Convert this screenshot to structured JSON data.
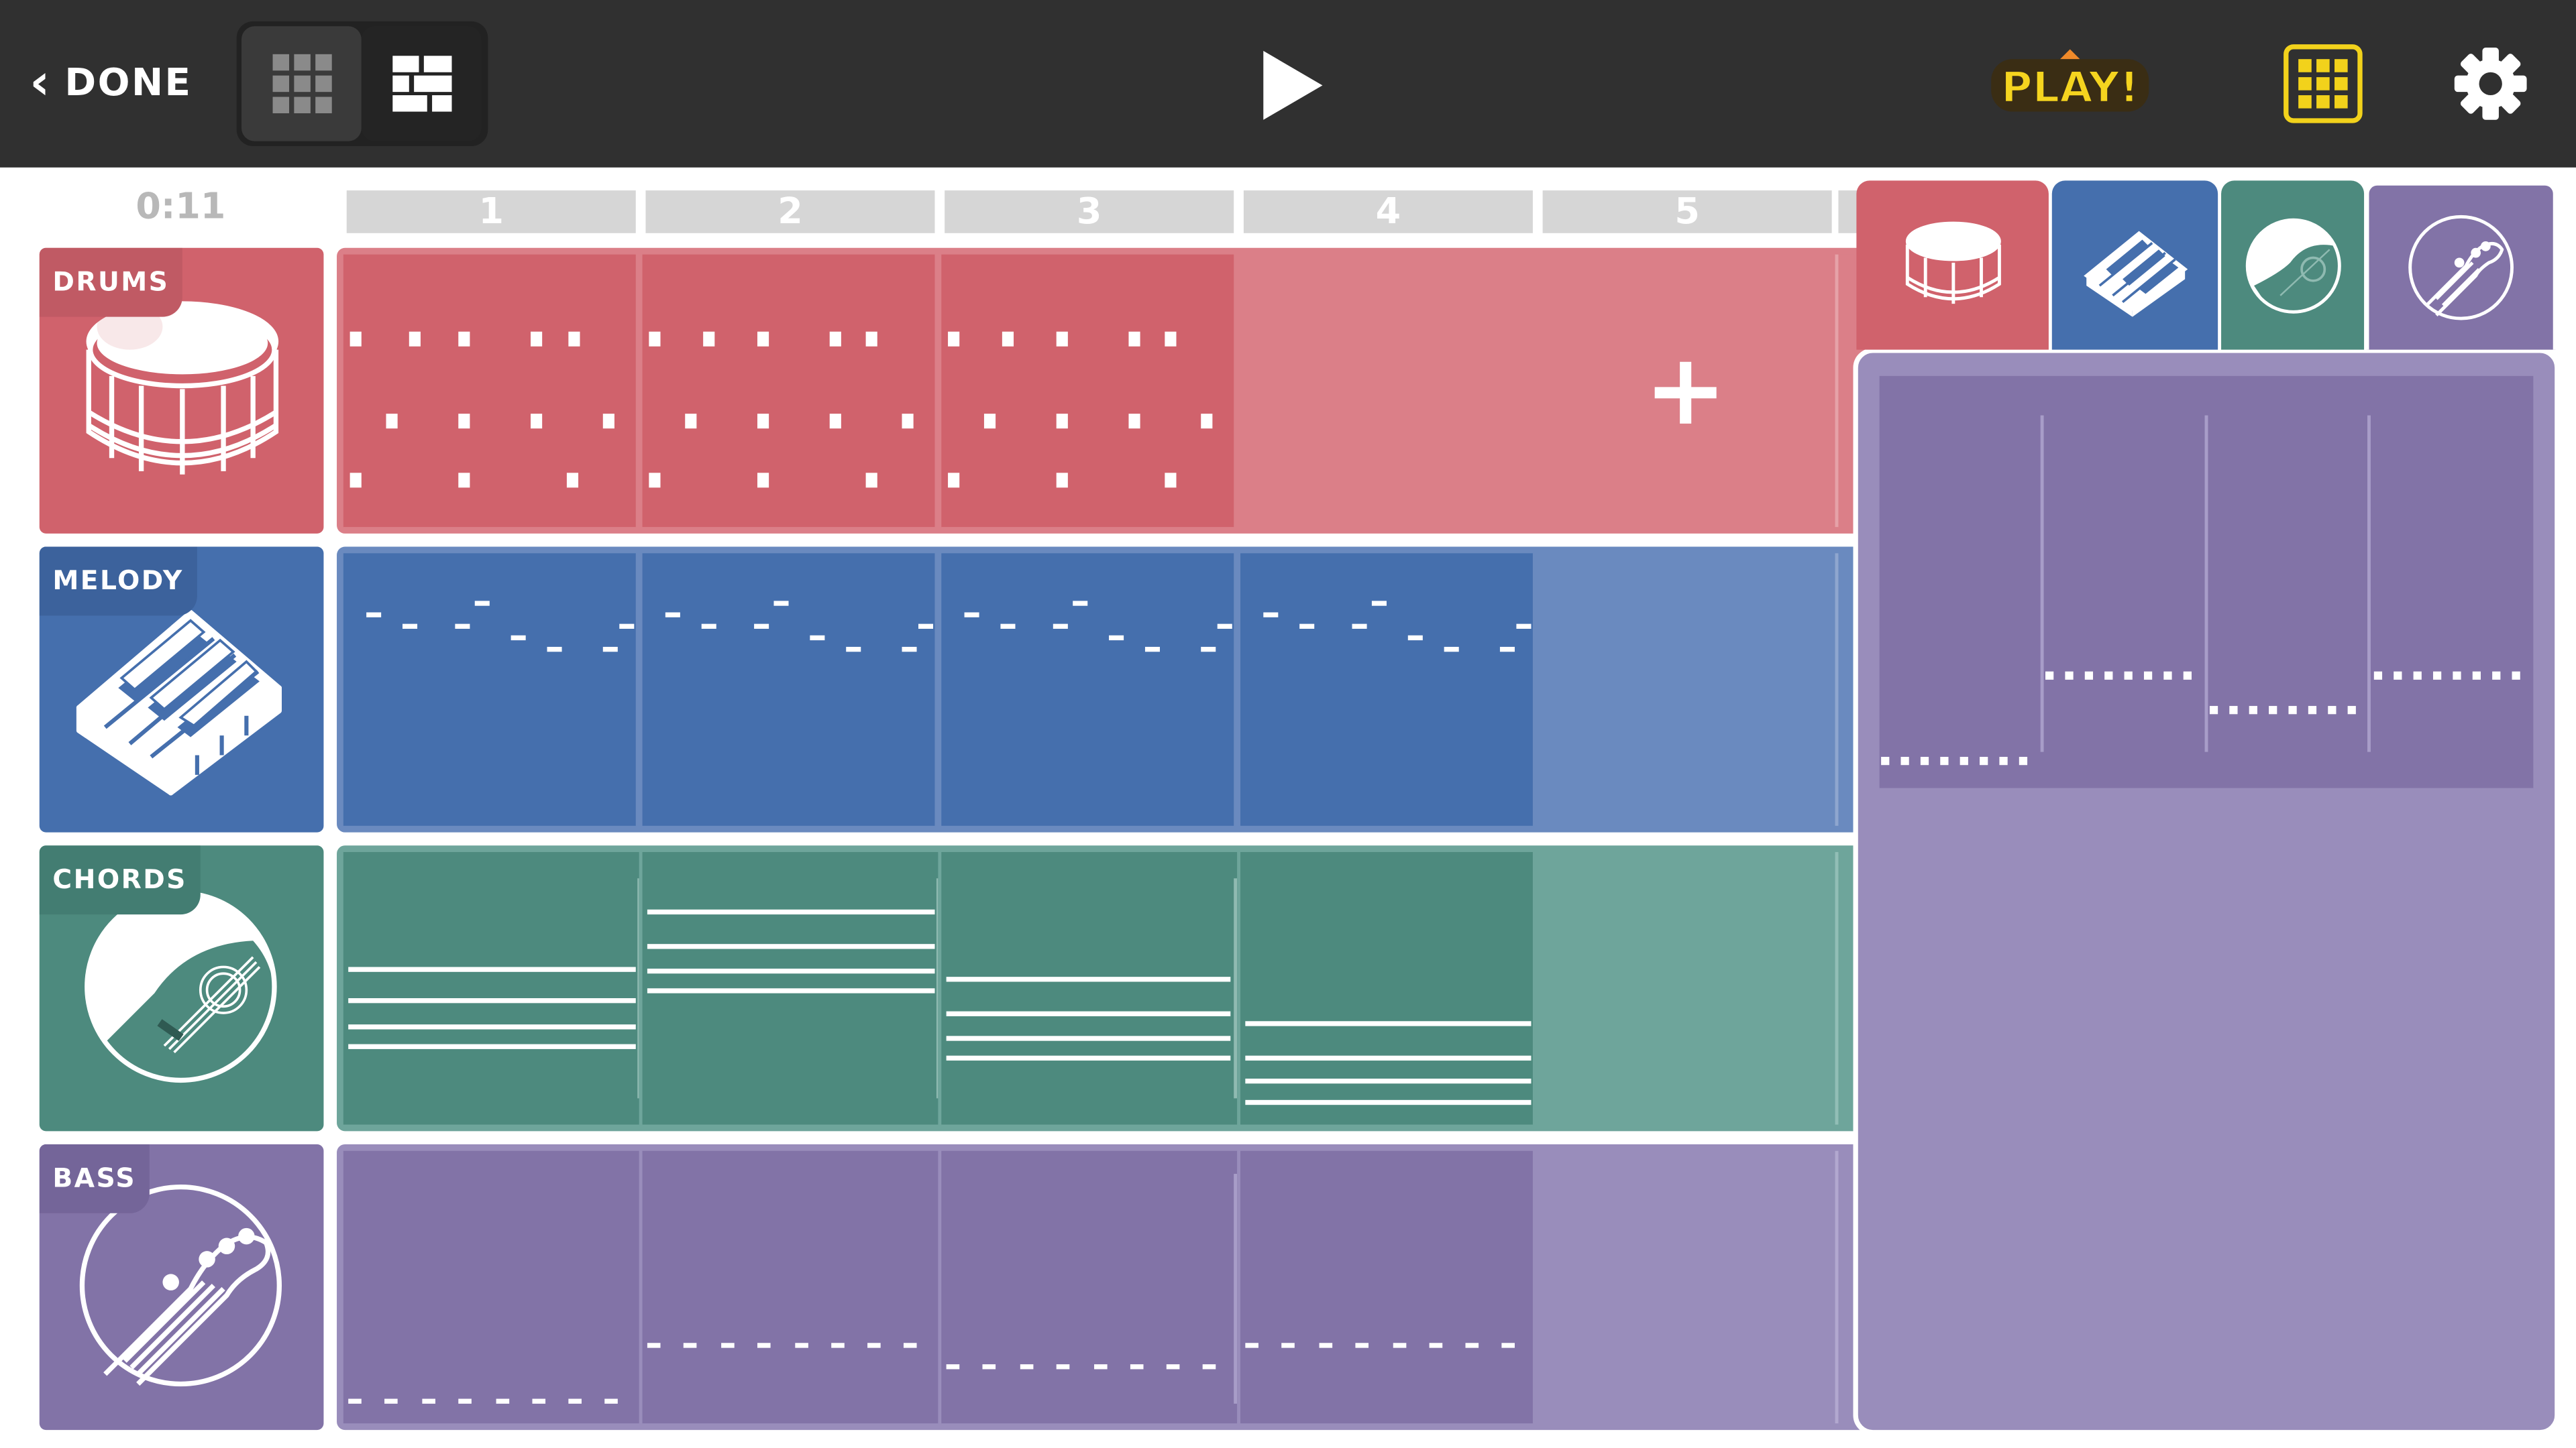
{
  "topbar": {
    "done_label": "DONE",
    "logo_text": "PLAY!",
    "icons": [
      "chevron-left-icon",
      "small-grid-icon",
      "list-grid-icon",
      "play-icon",
      "grid-icon",
      "gear-icon"
    ],
    "accent_color": "#f2d21b",
    "bg_color": "#303030"
  },
  "timeline": {
    "time": "0:11",
    "bars": [
      "1",
      "2",
      "3",
      "4",
      "5"
    ]
  },
  "tracks": [
    {
      "id": "drums",
      "label": "DRUMS",
      "icon": "snare-drum-icon",
      "color": "#d0626c",
      "faded": "#db7f88"
    },
    {
      "id": "melody",
      "label": "MELODY",
      "icon": "piano-keys-icon",
      "color": "#456fad",
      "faded": "#6a8abf"
    },
    {
      "id": "chords",
      "label": "CHORDS",
      "icon": "acoustic-guitar-icon",
      "color": "#4d8a7e",
      "faded": "#6ea59b"
    },
    {
      "id": "bass",
      "label": "BASS",
      "icon": "bass-guitar-headstock-icon",
      "color": "#8273a7",
      "faded": "#998dbb"
    }
  ],
  "panel": {
    "tabs": [
      "drums",
      "melody",
      "chords",
      "bass"
    ],
    "selected_tab": "bass"
  }
}
